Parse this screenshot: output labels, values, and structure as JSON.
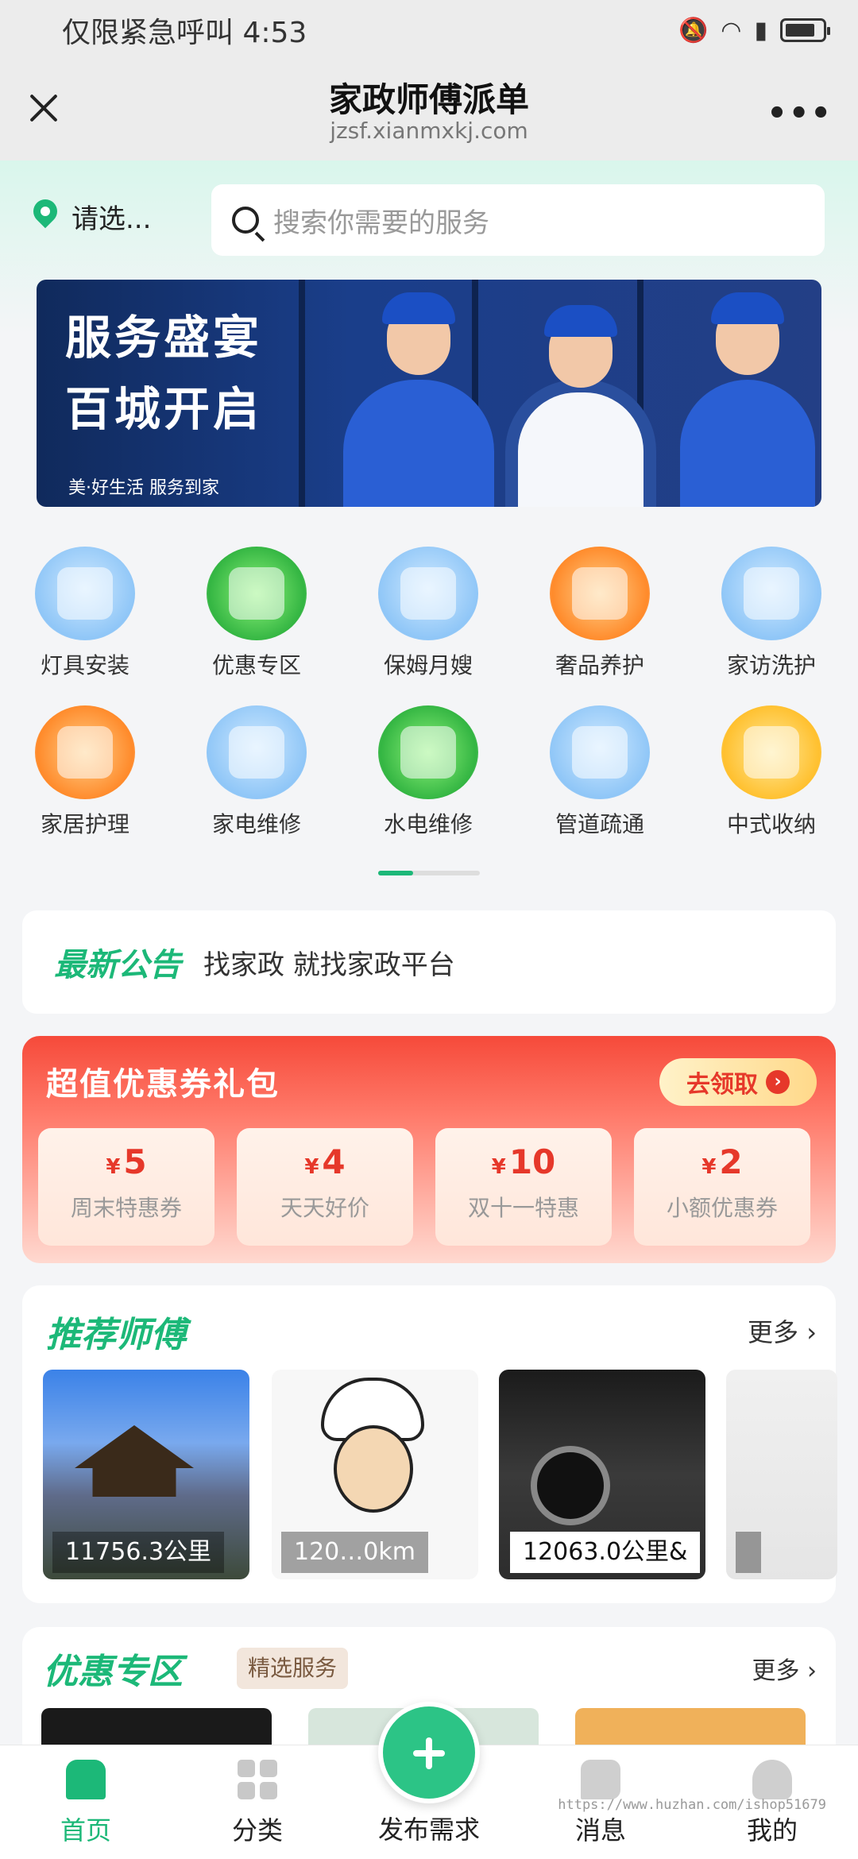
{
  "status_bar": {
    "carrier_time": "仅限紧急呼叫 4:53"
  },
  "titlebar": {
    "title": "家政师傅派单",
    "url": "jzsf.xianmxkj.com",
    "more": "•••"
  },
  "location": {
    "label": "请选..."
  },
  "search": {
    "placeholder": "搜索你需要的服务"
  },
  "banner": {
    "line1": "服务盛宴",
    "line2": "百城开启",
    "line3": "美·好生活 服务到家"
  },
  "categories": [
    {
      "label": "灯具安装",
      "icon": "lamp-install-icon"
    },
    {
      "label": "优惠专区",
      "icon": "discount-zone-icon"
    },
    {
      "label": "保姆月嫂",
      "icon": "washing-machine-icon"
    },
    {
      "label": "奢品养护",
      "icon": "handbag-icon"
    },
    {
      "label": "家访洗护",
      "icon": "bed-icon"
    },
    {
      "label": "家居护理",
      "icon": "sofa-icon"
    },
    {
      "label": "家电维修",
      "icon": "air-conditioner-icon"
    },
    {
      "label": "水电维修",
      "icon": "ceiling-lamp-icon"
    },
    {
      "label": "管道疏通",
      "icon": "pipe-icon"
    },
    {
      "label": "中式收纳",
      "icon": "spray-bottle-icon"
    }
  ],
  "notice": {
    "title": "最新公告",
    "text": "找家政 就找家政平台"
  },
  "coupons": {
    "title": "超值优惠券礼包",
    "get_label": "去领取",
    "items": [
      {
        "symbol": "¥",
        "amount": "5",
        "name": "周末特惠券"
      },
      {
        "symbol": "¥",
        "amount": "4",
        "name": "天天好价"
      },
      {
        "symbol": "¥",
        "amount": "10",
        "name": "双十一特惠"
      },
      {
        "symbol": "¥",
        "amount": "2",
        "name": "小额优惠券"
      }
    ]
  },
  "recommend": {
    "title": "推荐师傅",
    "more": "更多 ›",
    "cards": [
      {
        "distance": "11756.3公里"
      },
      {
        "distance": "120…0km"
      },
      {
        "distance": "12063.0公里&"
      },
      {
        "distance": ""
      }
    ]
  },
  "discounts": {
    "title": "优惠专区",
    "tag": "精选服务",
    "more": "更多 ›"
  },
  "nav": {
    "home": "首页",
    "category": "分类",
    "publish": "发布需求",
    "messages": "消息",
    "mine": "我的"
  },
  "watermark": "https://www.huzhan.com/ishop51679",
  "colors": {
    "brand_green": "#1cb878",
    "coupon_red": "#e6382a"
  }
}
